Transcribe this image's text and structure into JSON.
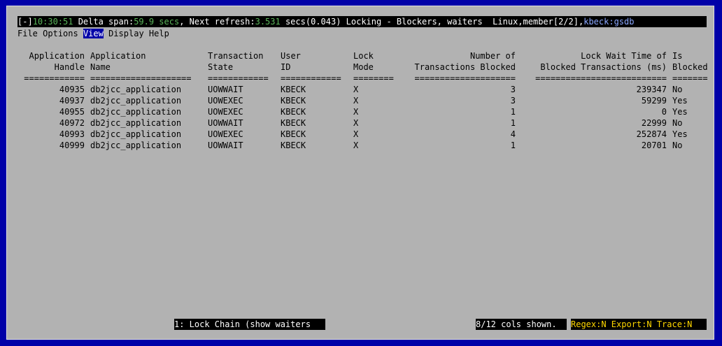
{
  "status": {
    "collapse_toggle": "[-]",
    "time": "10:30:51",
    "delta_label": " Delta span:",
    "delta_value": "59.9 secs",
    "refresh_label": ", Next refresh:",
    "refresh_value": "3.531",
    "refresh_tail": " secs(0.043) ",
    "view_title": "Locking - Blockers, waiters",
    "system": "  Linux,member[2/2],",
    "connection": "kbeck:gsdb"
  },
  "menu": [
    {
      "label": "File"
    },
    {
      "label": "Options"
    },
    {
      "label": "View",
      "active": true
    },
    {
      "label": "Display"
    },
    {
      "label": "Help"
    }
  ],
  "columns": [
    {
      "key": "handle",
      "line1": "Application",
      "line2": "Handle",
      "sep": "============",
      "align": "right"
    },
    {
      "key": "name",
      "line1": "Application",
      "line2": "Name",
      "sep": "====================",
      "align": "left"
    },
    {
      "key": "state",
      "line1": "Transaction",
      "line2": "State",
      "sep": "============",
      "align": "left"
    },
    {
      "key": "user",
      "line1": "User",
      "line2": "ID",
      "sep": "============",
      "align": "left"
    },
    {
      "key": "mode",
      "line1": "Lock",
      "line2": "Mode",
      "sep": "========",
      "align": "left"
    },
    {
      "key": "blocked_count",
      "line1": "Number of",
      "line2": "Transactions Blocked",
      "sep": "====================",
      "align": "right"
    },
    {
      "key": "wait_time",
      "line1": "Lock Wait Time of",
      "line2": "Blocked Transactions (ms)",
      "sep": "==========================",
      "align": "right"
    },
    {
      "key": "is_blocked",
      "line1": "Is",
      "line2": "Blocked",
      "sep": "=======",
      "align": "left"
    }
  ],
  "rows": [
    {
      "handle": "40935",
      "name": "db2jcc_application",
      "state": "UOWWAIT",
      "user": "KBECK",
      "mode": "X",
      "blocked_count": "3",
      "wait_time": "239347",
      "is_blocked": "No"
    },
    {
      "handle": "40937",
      "name": "db2jcc_application",
      "state": "UOWEXEC",
      "user": "KBECK",
      "mode": "X",
      "blocked_count": "3",
      "wait_time": "59299",
      "is_blocked": "Yes"
    },
    {
      "handle": "40955",
      "name": "db2jcc_application",
      "state": "UOWEXEC",
      "user": "KBECK",
      "mode": "X",
      "blocked_count": "1",
      "wait_time": "0",
      "is_blocked": "Yes"
    },
    {
      "handle": "40972",
      "name": "db2jcc_application",
      "state": "UOWWAIT",
      "user": "KBECK",
      "mode": "X",
      "blocked_count": "1",
      "wait_time": "22999",
      "is_blocked": "No"
    },
    {
      "handle": "40993",
      "name": "db2jcc_application",
      "state": "UOWEXEC",
      "user": "KBECK",
      "mode": "X",
      "blocked_count": "4",
      "wait_time": "252874",
      "is_blocked": "Yes"
    },
    {
      "handle": "40999",
      "name": "db2jcc_application",
      "state": "UOWWAIT",
      "user": "KBECK",
      "mode": "X",
      "blocked_count": "1",
      "wait_time": "20701",
      "is_blocked": "No"
    }
  ],
  "footer": {
    "view_hint": "1: Lock Chain (show waiters",
    "cols_shown": "8/12 cols shown.",
    "flags": "Regex:N Export:N Trace:N"
  }
}
